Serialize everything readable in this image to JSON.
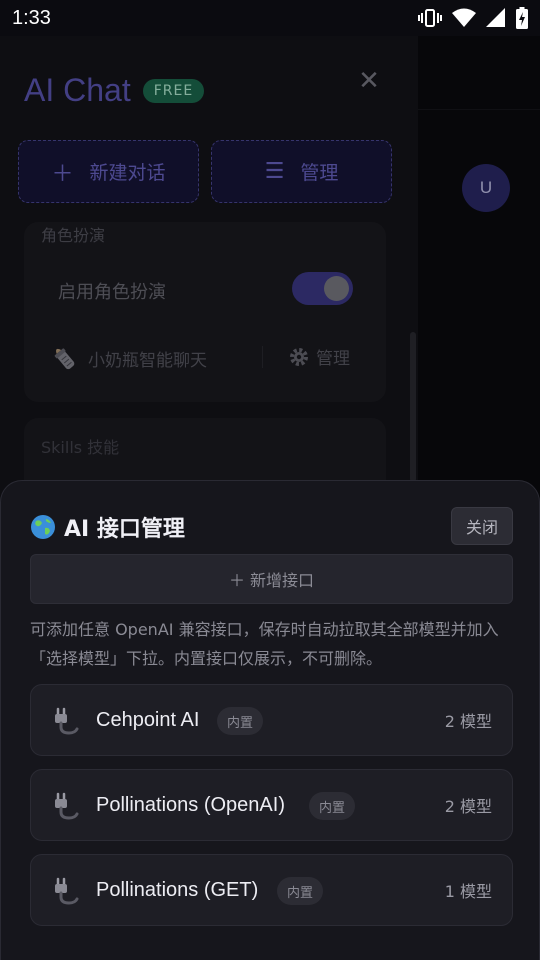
{
  "status_bar": {
    "time": "1:33"
  },
  "drawer": {
    "brand_title": "AI Chat",
    "brand_badge": "FREE",
    "close_symbol": "✕",
    "new_chat_label": "新建对话",
    "manage_label": "管理",
    "roleplay_section": "角色扮演",
    "roleplay_toggle_label": "启用角色扮演",
    "roleplay_enabled": true,
    "bot_name": "小奶瓶智能聊天",
    "bot_manage_label": "管理",
    "skills_section": "Skills 技能"
  },
  "main": {
    "avatar_letter": "U"
  },
  "sheet": {
    "title": "AI 接口管理",
    "close_label": "关闭",
    "add_label": "＋ 新增接口",
    "hint": "可添加任意 OpenAI 兼容接口，保存时自动拉取其全部模型并加入「选择模型」下拉。内置接口仅展示，不可删除。",
    "endpoints": [
      {
        "name": "Cehpoint AI",
        "tag": "内置",
        "count": "2 模型"
      },
      {
        "name": "Pollinations (OpenAI)",
        "tag": "内置",
        "count": "2 模型"
      },
      {
        "name": "Pollinations (GET)",
        "tag": "内置",
        "count": "1 模型"
      }
    ]
  },
  "icons": {
    "globe": "globe-icon",
    "plug": "plug-icon",
    "plus": "plus-icon",
    "menu": "menu-icon",
    "gear": "gear-icon",
    "bottle": "baby-bottle-icon",
    "close": "close-icon"
  },
  "colors": {
    "accent": "#5d58b8",
    "badge": "#1d6b4f",
    "sheet_bg": "#16161c"
  }
}
